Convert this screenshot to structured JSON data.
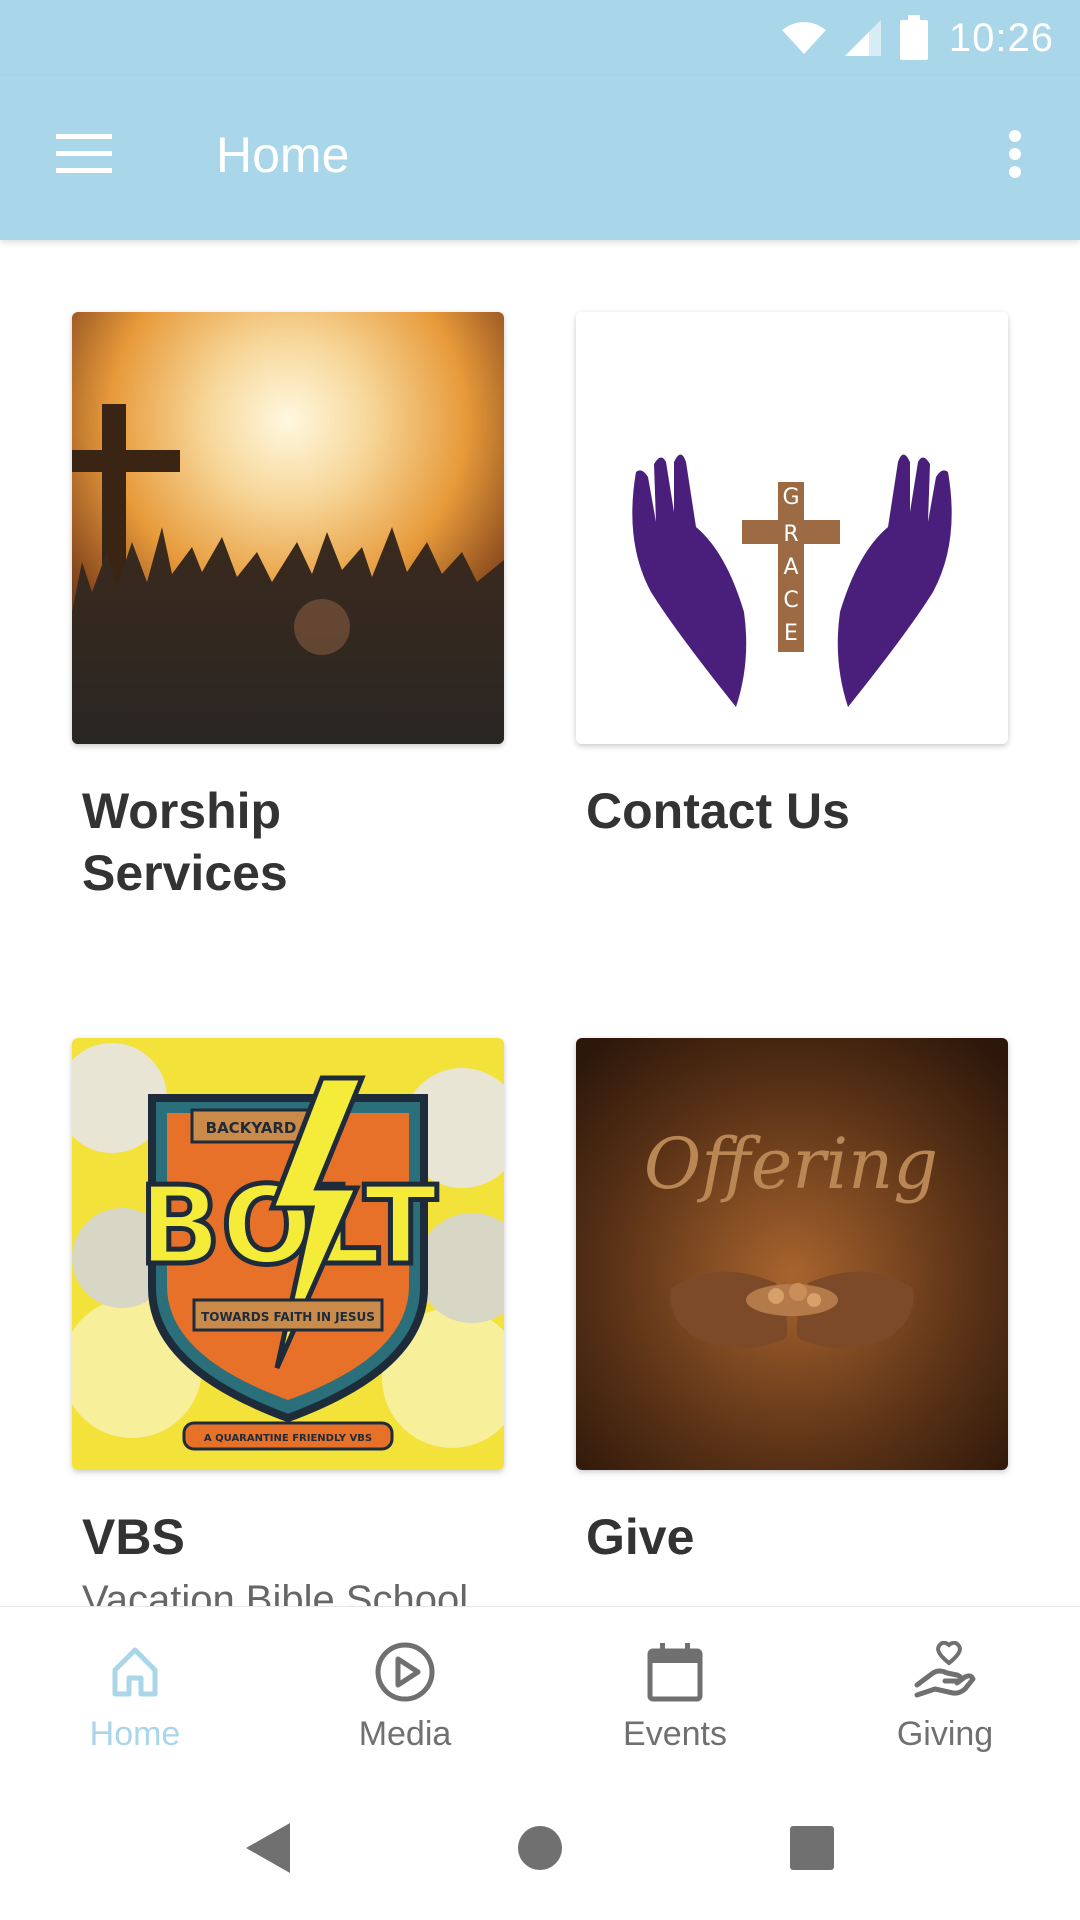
{
  "status_bar": {
    "time": "10:26"
  },
  "app_bar": {
    "title": "Home"
  },
  "tiles": [
    {
      "title": "Worship\nServices",
      "image": "sunset-cross-worship-image"
    },
    {
      "title": "Contact Us",
      "image": "grace-hands-cross-logo"
    },
    {
      "title": "VBS",
      "subtitle": "Vacation Bible School",
      "image": "backyard-bolt-vbs-image",
      "image_text": {
        "top": "BACKYARD",
        "main": "BOLT",
        "ribbon": "TOWARDS FAITH IN JESUS",
        "footer": "A QUARANTINE FRIENDLY VBS"
      }
    },
    {
      "title": "Give",
      "image": "offering-hands-image",
      "image_text": {
        "main": "Offering"
      }
    }
  ],
  "grace_logo_letters": [
    "G",
    "R",
    "A",
    "C",
    "E"
  ],
  "bottom_nav": [
    {
      "label": "Home",
      "icon": "home-icon",
      "active": true
    },
    {
      "label": "Media",
      "icon": "play-circle-icon",
      "active": false
    },
    {
      "label": "Events",
      "icon": "calendar-icon",
      "active": false
    },
    {
      "label": "Giving",
      "icon": "giving-hand-heart-icon",
      "active": false
    }
  ],
  "colors": {
    "primary": "#a9d6e8",
    "text_dark": "#333333",
    "text_muted": "#707070",
    "logo_purple": "#4a1f7c",
    "logo_brown": "#9c6b43"
  }
}
